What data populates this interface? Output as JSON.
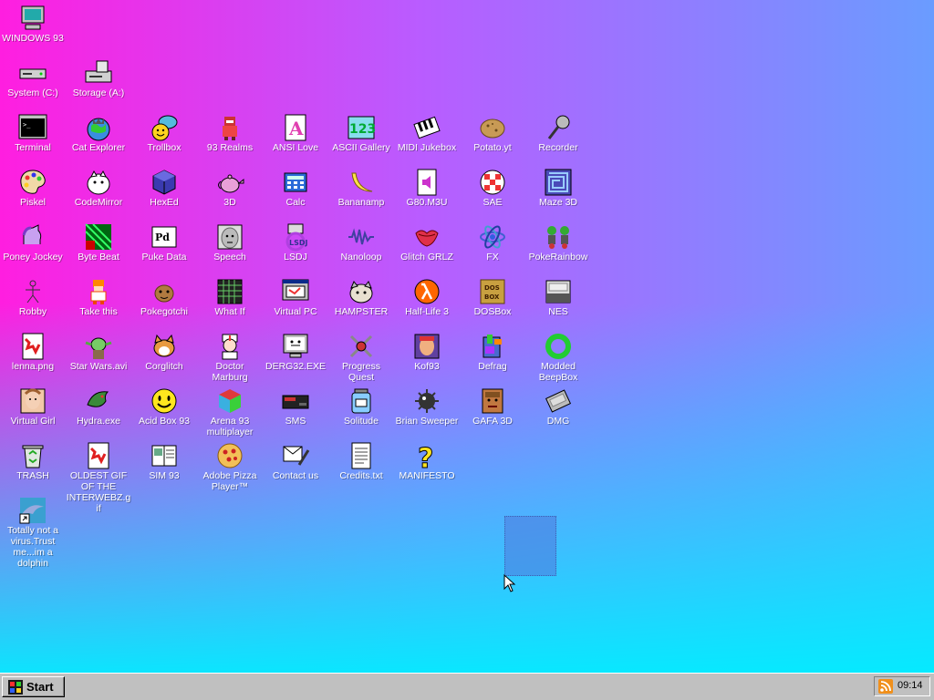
{
  "desktop": {
    "icons": [
      {
        "label": "WINDOWS 93",
        "icon": "computer-icon"
      },
      {
        "label": "System (C:)",
        "icon": "drive-icon"
      },
      {
        "label": "Storage (A:)",
        "icon": "floppy-drive-icon"
      },
      {
        "label": "Terminal",
        "icon": "terminal-icon"
      },
      {
        "label": "Cat Explorer",
        "icon": "globe-cat-icon"
      },
      {
        "label": "Trollbox",
        "icon": "chat-smiley-icon"
      },
      {
        "label": "93 Realms",
        "icon": "knight-icon"
      },
      {
        "label": "ANSI Love",
        "icon": "letter-a-icon"
      },
      {
        "label": "ASCII Gallery",
        "icon": "numbers-icon"
      },
      {
        "label": "MIDI Jukebox",
        "icon": "piano-icon"
      },
      {
        "label": "Potato.yt",
        "icon": "potato-icon"
      },
      {
        "label": "Recorder",
        "icon": "microphone-icon"
      },
      {
        "label": "Piskel",
        "icon": "palette-icon"
      },
      {
        "label": "CodeMirror",
        "icon": "cat-mirror-icon"
      },
      {
        "label": "HexEd",
        "icon": "cube-icon"
      },
      {
        "label": "3D",
        "icon": "teapot-icon"
      },
      {
        "label": "Calc",
        "icon": "calculator-icon"
      },
      {
        "label": "Bananamp",
        "icon": "banana-icon"
      },
      {
        "label": "G80.M3U",
        "icon": "audio-file-icon"
      },
      {
        "label": "SAE",
        "icon": "checker-ball-icon"
      },
      {
        "label": "Maze 3D",
        "icon": "maze-icon"
      },
      {
        "label": "Poney Jockey",
        "icon": "pony-icon"
      },
      {
        "label": "Byte Beat",
        "icon": "byte-beat-icon"
      },
      {
        "label": "Puke Data",
        "icon": "pd-icon"
      },
      {
        "label": "Speech",
        "icon": "face-icon"
      },
      {
        "label": "LSDJ",
        "icon": "lsdj-icon"
      },
      {
        "label": "Nanoloop",
        "icon": "waveform-icon"
      },
      {
        "label": "Glitch GRLZ",
        "icon": "lips-icon"
      },
      {
        "label": "FX",
        "icon": "atom-icon"
      },
      {
        "label": "PokeRainbow",
        "icon": "trainers-icon"
      },
      {
        "label": "Robby",
        "icon": "stick-figure-icon"
      },
      {
        "label": "Take this",
        "icon": "pixel-man-icon"
      },
      {
        "label": "Pokegotchi",
        "icon": "creature-icon"
      },
      {
        "label": "What If",
        "icon": "grid-window-icon"
      },
      {
        "label": "Virtual PC",
        "icon": "virtual-pc-icon"
      },
      {
        "label": "HAMPSTER",
        "icon": "hamster-icon"
      },
      {
        "label": "Half-Life 3",
        "icon": "lambda-icon"
      },
      {
        "label": "DOSBox",
        "icon": "dosbox-icon"
      },
      {
        "label": "NES",
        "icon": "nes-console-icon"
      },
      {
        "label": "lenna.png",
        "icon": "image-file-icon"
      },
      {
        "label": "Star Wars.avi",
        "icon": "yoda-icon"
      },
      {
        "label": "Corglitch",
        "icon": "corgi-icon"
      },
      {
        "label": "Doctor Marburg",
        "icon": "doctor-icon"
      },
      {
        "label": "DERG32.EXE",
        "icon": "derg-monitor-icon"
      },
      {
        "label": "Progress Quest",
        "icon": "crossed-swords-icon"
      },
      {
        "label": "Kof93",
        "icon": "fighter-icon"
      },
      {
        "label": "Defrag",
        "icon": "defrag-icon"
      },
      {
        "label": "Modded BeepBox",
        "icon": "green-ring-icon"
      },
      {
        "label": "Virtual Girl",
        "icon": "portrait-icon"
      },
      {
        "label": "Hydra.exe",
        "icon": "dragon-icon"
      },
      {
        "label": "Acid Box 93",
        "icon": "acid-smiley-icon"
      },
      {
        "label": "Arena 93 multiplayer",
        "icon": "color-cube-icon"
      },
      {
        "label": "SMS",
        "icon": "sms-console-icon"
      },
      {
        "label": "Solitude",
        "icon": "jar-icon"
      },
      {
        "label": "Brian Sweeper",
        "icon": "mine-icon"
      },
      {
        "label": "GAFA 3D",
        "icon": "doom-face-icon"
      },
      {
        "label": "DMG",
        "icon": "gameboy-cart-icon"
      },
      {
        "label": "TRASH",
        "icon": "recycle-bin-icon"
      },
      {
        "label": "OLDEST GIF OF THE INTERWEBZ.gif",
        "icon": "gif-file-icon"
      },
      {
        "label": "SIM 93",
        "icon": "book-icon"
      },
      {
        "label": "Adobe Pizza Player™",
        "icon": "pizza-icon"
      },
      {
        "label": "Contact us",
        "icon": "contact-icon"
      },
      {
        "label": "Credits.txt",
        "icon": "text-file-icon"
      },
      {
        "label": "MANIFESTO",
        "icon": "question-mark-icon"
      },
      {
        "label": "Totally not a virus.Trust me...im a dolphin",
        "icon": "dolphin-shortcut-icon"
      }
    ]
  },
  "taskbar": {
    "start_label": "Start",
    "clock": "09:14",
    "tray_icon": "rss-icon"
  },
  "colors": {
    "gradient_top_left": "#ff1ee0",
    "gradient_mid": "#b95cff",
    "gradient_bottom_right": "#00eeff",
    "taskbar": "#c0c0c0"
  }
}
